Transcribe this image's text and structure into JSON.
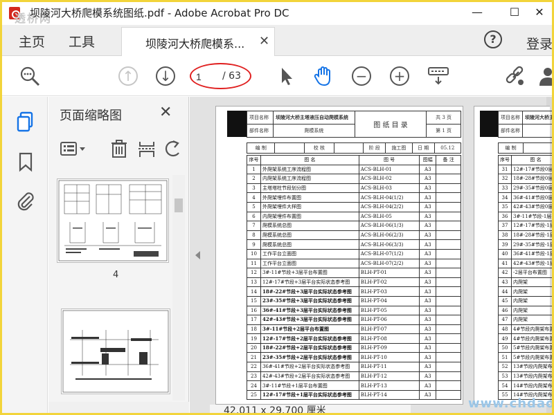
{
  "window": {
    "title": "坝陵河大桥爬模系统图纸.pdf - Adobe Acrobat Pro DC",
    "watermark_top": "透桥网",
    "minimize": "—",
    "maximize": "☐",
    "close": "✕"
  },
  "menu": {
    "home": "主页",
    "tools": "工具",
    "doc_tab": "坝陵河大桥爬模系...",
    "doc_tab_close": "✕",
    "help": "?",
    "login": "登录"
  },
  "toolbar": {
    "page_current": "1",
    "page_total": "/ 63",
    "zoom_out": "−",
    "zoom_in": "+"
  },
  "panel": {
    "title": "页面缩略图",
    "close": "✕",
    "thumb_label": "4"
  },
  "status": {
    "dimensions": "42.011 x 29.700 厘米"
  },
  "watermark_bottom": "www.chdao.com",
  "drawing": {
    "project_label": "项目名称",
    "project_name": "坝陵河大桥主塔液压自动爬模系统",
    "part_label": "部件名称",
    "part_name": "爬模系统",
    "title": "图  纸  目  录",
    "total_pages": "共 3 页",
    "page_no": "第 1 页",
    "edit": "编  制",
    "check": "校  核",
    "stage_label": "阶  段",
    "stage": "施工图",
    "date_label": "日  期",
    "date": "05.12",
    "col_no": "序号",
    "col_name": "图      名",
    "col_code": "图      号",
    "col_size": "图幅",
    "col_note": "备  注",
    "rows": [
      {
        "no": "1",
        "name": "外爬架系统工序流程图",
        "code": "ACS-BLH-01",
        "size": "A3"
      },
      {
        "no": "2",
        "name": "内爬架系统工序流程图",
        "code": "ACS-BLH-02",
        "size": "A3"
      },
      {
        "no": "3",
        "name": "主塔塔柱节段划分图",
        "code": "ACS-BLH-03",
        "size": "A3"
      },
      {
        "no": "4",
        "name": "外爬架埋件布置图",
        "code": "ACS-BLH-04(1/2)",
        "size": "A3"
      },
      {
        "no": "5",
        "name": "外爬架埋件大样图",
        "code": "ACS-BLH-04(2/2)",
        "size": "A3"
      },
      {
        "no": "6",
        "name": "内爬架埋件布置图",
        "code": "ACS-BLH-05",
        "size": "A3"
      },
      {
        "no": "7",
        "name": "爬模系统总图",
        "code": "ACS-BLH-06(1/3)",
        "size": "A3"
      },
      {
        "no": "8",
        "name": "爬模系统总图",
        "code": "ACS-BLH-06(2/3)",
        "size": "A3"
      },
      {
        "no": "9",
        "name": "爬模系统总图",
        "code": "ACS-BLH-06(3/3)",
        "size": "A3"
      },
      {
        "no": "10",
        "name": "工作平台立面图",
        "code": "ACS-BLH-07(1/2)",
        "size": "A3"
      },
      {
        "no": "11",
        "name": "工作平台立面图",
        "code": "ACS-BLH-07(2/2)",
        "size": "A3"
      },
      {
        "no": "12",
        "name": "3#-11#节段+3层平台布置图",
        "code": "BLH-PT-01",
        "size": "A3"
      },
      {
        "no": "13",
        "name": "12#-17#节段+3层平台实际状态参考图",
        "code": "BLH-PT-02",
        "size": "A3"
      },
      {
        "no": "14",
        "name": "18#-22#节段+3层平台实际状态参考图",
        "code": "BLH-PT-03",
        "size": "A3",
        "bold": true
      },
      {
        "no": "15",
        "name": "23#-35#节段+3层平台实际状态参考图",
        "code": "BLH-PT-04",
        "size": "A3",
        "bold": true
      },
      {
        "no": "16",
        "name": "36#-41#节段+3层平台实际状态参考图",
        "code": "BLH-PT-05",
        "size": "A3",
        "bold": true
      },
      {
        "no": "17",
        "name": "42#-43#节段+3层平台实际状态参考图",
        "code": "BLH-PT-06",
        "size": "A3",
        "bold": true
      },
      {
        "no": "18",
        "name": "3#-11#节段+2层平台布置图",
        "code": "BLH-PT-07",
        "size": "A3",
        "bold": true
      },
      {
        "no": "19",
        "name": "12#-17#节段+2层平台实际状态参考图",
        "code": "BLH-PT-08",
        "size": "A3",
        "bold": true
      },
      {
        "no": "20",
        "name": "18#-22#节段+2层平台实际状态参考图",
        "code": "BLH-PT-09",
        "size": "A3",
        "bold": true
      },
      {
        "no": "21",
        "name": "23#-35#节段+2层平台实际状态参考图",
        "code": "BLH-PT-10",
        "size": "A3",
        "bold": true
      },
      {
        "no": "22",
        "name": "36#-41#节段+2层平台实际状态参考图",
        "code": "BLH-PT-11",
        "size": "A3"
      },
      {
        "no": "23",
        "name": "42#-43#节段+2层平台实际状态参考图",
        "code": "BLH-PT-12",
        "size": "A3"
      },
      {
        "no": "24",
        "name": "3#-11#节段+1层平台布置图",
        "code": "BLH-PT-13",
        "size": "A3"
      },
      {
        "no": "25",
        "name": "12#-17#节段+1层平台实际状态参考图",
        "code": "BLH-PT-14",
        "size": "A3",
        "bold": true
      }
    ],
    "right_rows": [
      {
        "no": "31",
        "name": "12#-17#节段0层平"
      },
      {
        "no": "32",
        "name": "18#-28#节段0层平"
      },
      {
        "no": "33",
        "name": "29#-35#节段0层平"
      },
      {
        "no": "34",
        "name": "36#-41#节段0层平"
      },
      {
        "no": "35",
        "name": "42#-43#节段0层平"
      },
      {
        "no": "36",
        "name": "3#-11#节段-1层平"
      },
      {
        "no": "37",
        "name": "12#-17#节段-1层"
      },
      {
        "no": "38",
        "name": "18#-28#节段-1层"
      },
      {
        "no": "39",
        "name": "29#-35#节段-1层"
      },
      {
        "no": "40",
        "name": "36#-41#节段-1层"
      },
      {
        "no": "41",
        "name": "42#-43#节段-1层"
      },
      {
        "no": "42",
        "name": "-2层平台布置图"
      },
      {
        "no": "43",
        "name": "内爬架"
      },
      {
        "no": "44",
        "name": "内爬架"
      },
      {
        "no": "45",
        "name": "内爬架"
      },
      {
        "no": "46",
        "name": "内爬架"
      },
      {
        "no": "47",
        "name": "内爬架"
      },
      {
        "no": "48",
        "name": "4#节段内爬架布置"
      },
      {
        "no": "49",
        "name": "4#节段内爬架布置"
      },
      {
        "no": "50",
        "name": "5#节段内爬架布置"
      },
      {
        "no": "51",
        "name": "5#节段内爬架布置"
      },
      {
        "no": "52",
        "name": "13#节段内爬架布置"
      },
      {
        "no": "53",
        "name": "13#节段内爬架布置"
      },
      {
        "no": "54",
        "name": "14#节段内爬架布置"
      },
      {
        "no": "55",
        "name": "14#节段内爬架布置"
      }
    ]
  }
}
